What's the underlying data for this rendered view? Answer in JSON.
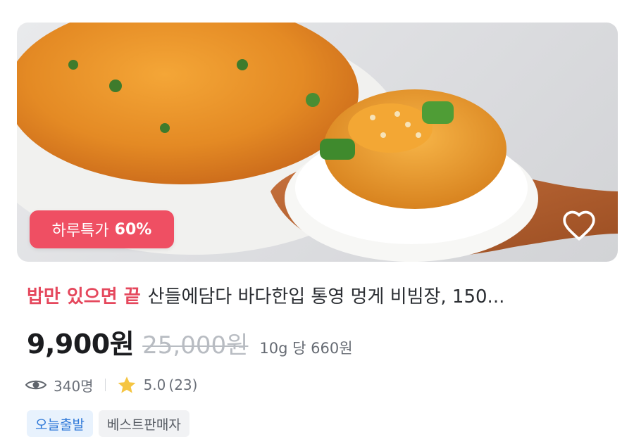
{
  "product": {
    "image_alt": "Tongyeong sea squirt bibimjang on rice with spoon",
    "deal_badge": {
      "label": "하루특가",
      "percent": "60%"
    },
    "promo_label": "밥만 있으면 끝",
    "title": "산들에담다 바다한입 통영 멍게 비빔장, 150...",
    "price": "9,900원",
    "original_price": "25,000원",
    "unit_price": "10g 당 660원",
    "views": "340명",
    "rating": "5.0",
    "review_count": "(23)",
    "tags": [
      "오늘출발",
      "베스트판매자"
    ]
  },
  "icons": {
    "wishlist": "heart-outline-icon",
    "views": "eye-icon",
    "rating": "star-icon"
  },
  "colors": {
    "badge": "#ef4f63",
    "promo": "#e5485d",
    "star": "#f5c542",
    "tag_blue_text": "#2e78d8",
    "tag_blue_bg": "#e8f2fd"
  }
}
